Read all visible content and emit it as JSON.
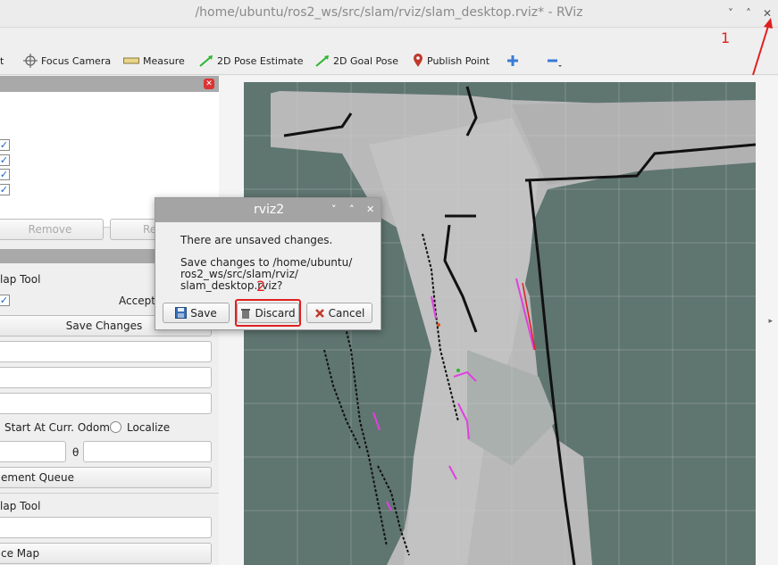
{
  "window": {
    "title": "/home/ubuntu/ros2_ws/src/slam/rviz/slam_desktop.rviz* - RViz",
    "controls": [
      "˅",
      "˄",
      "✕"
    ]
  },
  "toolbar": {
    "partial_left": "t",
    "focus_camera": "Focus Camera",
    "measure": "Measure",
    "pose_estimate": "2D Pose Estimate",
    "goal_pose": "2D Goal Pose",
    "publish_point": "Publish Point",
    "icons": [
      "focus-camera-icon",
      "measure-icon",
      "pose-arrow-icon",
      "goal-arrow-icon",
      "map-pin-icon",
      "plus-icon",
      "minus-icon"
    ]
  },
  "displays": {
    "checks": [
      "✓",
      "✓",
      "✓",
      "✓"
    ],
    "remove_button": "Remove",
    "rename_partial": "Re"
  },
  "slam_panel": {
    "tool_label_1": "lap Tool",
    "accept_label": "Accept",
    "accept_check": "✓",
    "save_changes": "Save Changes",
    "start_at_odom": "Start At Curr. Odom",
    "localize": "Localize",
    "theta": "θ",
    "queue_button": "ement Queue",
    "tool_label_2": "lap Tool",
    "map_button": "ce Map"
  },
  "dialog": {
    "title": "rviz2",
    "controls": [
      "˅",
      "˄",
      "✕"
    ],
    "message_line1": "There are unsaved changes.",
    "message_line2": "Save changes to /home/ubuntu/",
    "message_line3": "ros2_ws/src/slam/rviz/",
    "message_line4": "slam_desktop.rviz?",
    "save": "Save",
    "discard": "Discard",
    "cancel": "Cancel"
  },
  "annotations": {
    "marker1": "1",
    "marker2": "2",
    "color": "#e02020"
  },
  "colors": {
    "map_free": "#b9b9b9",
    "map_unknown": "#5f7570",
    "map_wall": "#111111",
    "scan": "#e040e0"
  }
}
